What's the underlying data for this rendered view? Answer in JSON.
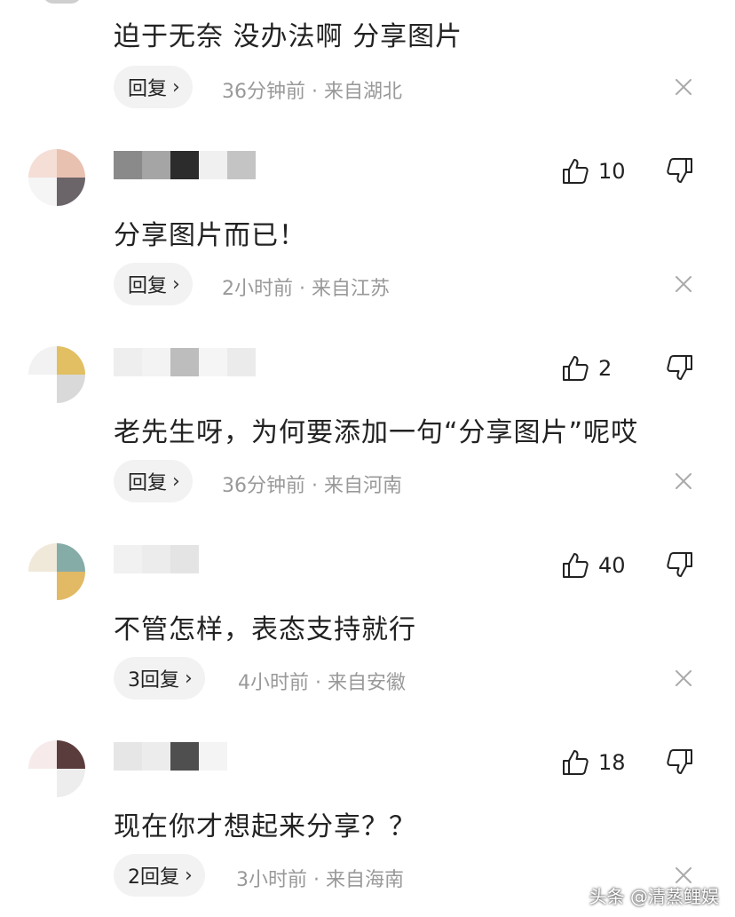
{
  "comments": [
    {
      "likes": "",
      "text": "迫于无奈 没办法啊 分享图片",
      "reply_label": "回复",
      "meta": "36分钟前 · 来自湖北"
    },
    {
      "likes": "10",
      "text": "分享图片而已！",
      "reply_label": "回复",
      "meta": "2小时前 · 来自江苏"
    },
    {
      "likes": "2",
      "text": "老先生呀，为何要添加一句“分享图片”呢哎",
      "reply_label": "回复",
      "meta": "36分钟前 · 来自河南"
    },
    {
      "likes": "40",
      "text": "不管怎样，表态支持就行",
      "reply_label": "3回复",
      "meta": "4小时前 · 来自安徽"
    },
    {
      "likes": "18",
      "text": "现在你才想起来分享？？",
      "reply_label": "2回复",
      "meta": "3小时前 · 来自海南"
    }
  ],
  "icons": {
    "like": "thumbs-up-icon",
    "dislike": "thumbs-down-icon",
    "close": "close-icon",
    "reply_chevron": "chevron-right-icon"
  },
  "watermark": "头条 @清蒸鲤娱"
}
